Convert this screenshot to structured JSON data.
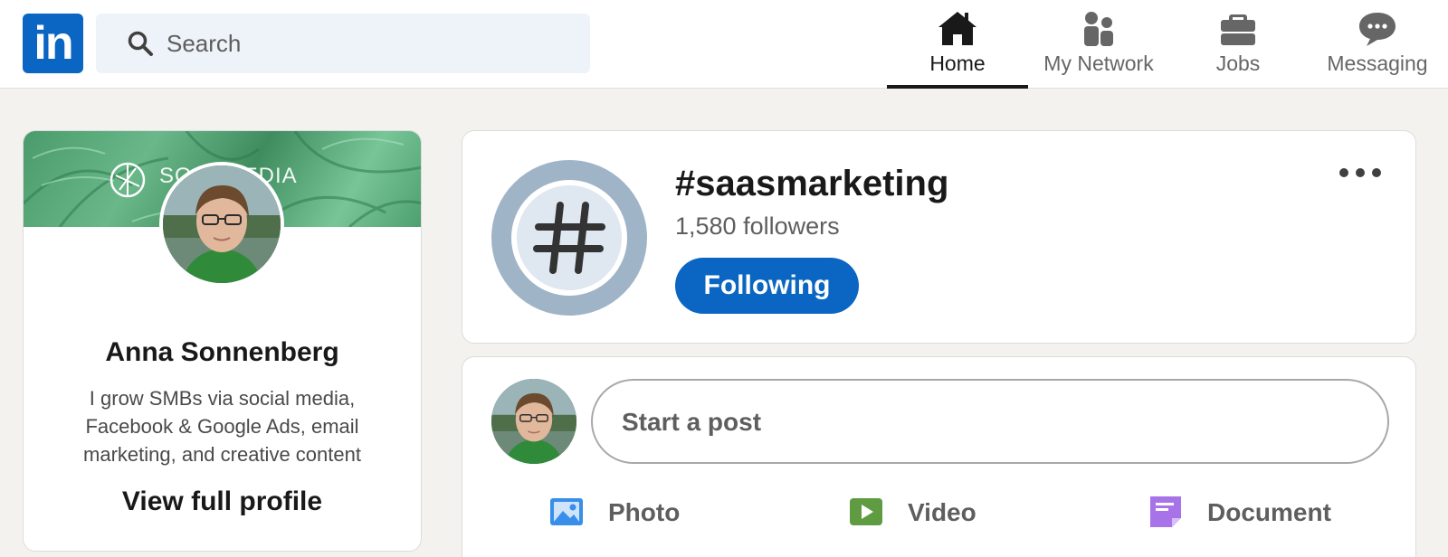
{
  "header": {
    "logo_text": "in",
    "search": {
      "placeholder": "Search",
      "value": ""
    },
    "nav": [
      {
        "label": "Home",
        "icon": "home-icon",
        "active": true
      },
      {
        "label": "My Network",
        "icon": "people-icon",
        "active": false
      },
      {
        "label": "Jobs",
        "icon": "briefcase-icon",
        "active": false
      },
      {
        "label": "Messaging",
        "icon": "chat-icon",
        "active": false
      }
    ]
  },
  "profile": {
    "banner_text": "SO        G MEDIA",
    "name": "Anna Sonnenberg",
    "bio": "I grow SMBs via social media, Facebook & Google Ads, email marketing, and creative content",
    "view_profile_label": "View full profile"
  },
  "hashtag": {
    "title": "#saasmarketing",
    "followers": "1,580 followers",
    "follow_button_label": "Following"
  },
  "composer": {
    "placeholder": "Start a post",
    "actions": [
      {
        "label": "Photo",
        "icon": "photo-icon",
        "color": "#378fe9"
      },
      {
        "label": "Video",
        "icon": "video-icon",
        "color": "#5f9b41"
      },
      {
        "label": "Document",
        "icon": "document-icon",
        "color": "#a872e8"
      }
    ]
  },
  "colors": {
    "brand": "#0a66c2",
    "background": "#f3f2ef"
  }
}
